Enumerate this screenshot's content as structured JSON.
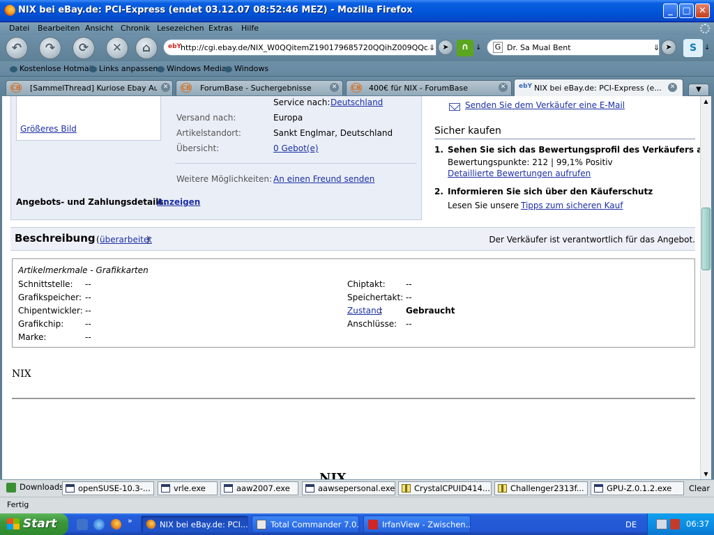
{
  "window": {
    "title": "NIX bei eBay.de: PCI-Express (endet 03.12.07 08:52:46 MEZ) - Mozilla Firefox",
    "min": "_",
    "max": "□",
    "close": "✕"
  },
  "menu": [
    "Datei",
    "Bearbeiten",
    "Ansicht",
    "Chronik",
    "Lesezeichen",
    "Extras",
    "Hilfe"
  ],
  "nav": {
    "back": "↶",
    "forward": "↷",
    "reload": "⟳",
    "stop": "✕",
    "home": "⌂",
    "url_favicon": "ebY",
    "url": "http://cgi.ebay.de/NIX_W0QQitemZ190179685720QQihZ009QQcategory",
    "url_drop": "⇓",
    "go": "➤",
    "rss": "∩",
    "rss_arrow": "↓",
    "search_engine": "G",
    "search_value": "Dr. Sa Mual Bent",
    "search_drop": "⇓",
    "search_go": "➤",
    "skype": "S",
    "skype_arrow": "↓"
  },
  "bookmarks": [
    "Kostenlose Hotmail",
    "Links anpassen",
    "Windows Media",
    "Windows"
  ],
  "tabs": [
    {
      "icon": "CB",
      "label": "[SammelThread] Kuriose Ebay Auk...",
      "close": "✕"
    },
    {
      "icon": "CB",
      "label": "ForumBase - Suchergebnisse",
      "close": "✕"
    },
    {
      "icon": "CB",
      "label": "400€ für NIX - ForumBase",
      "close": "✕"
    },
    {
      "icon": "ebY",
      "label": "NIX bei eBay.de: PCI-Express (e...",
      "close": "✕"
    }
  ],
  "tab_list": "▼",
  "item": {
    "bigger_image": "Größeres Bild",
    "service_label": "Service nach:",
    "service_value": "Deutschland",
    "shipping_label": "Versand nach:",
    "shipping_value": "Europa",
    "location_label": "Artikelstandort:",
    "location_value": "Sankt Englmar, Deutschland",
    "overview_label": "Übersicht:",
    "overview_value": "0 Gebot(e)",
    "more_label": "Weitere Möglichkeiten:",
    "more_value": "An einen Freund senden",
    "payment_label": "Angebots- und Zahlungsdetails:",
    "payment_link": "Anzeigen"
  },
  "seller": {
    "mail_link": "Senden Sie dem Verkäufer eine E-Mail",
    "safe_title": "Sicher kaufen",
    "step1_num": "1.",
    "step1_title": "Sehen Sie sich das Bewertungsprofil des Verkäufers an",
    "step1_score": "Bewertungspunkte: 212 | 99,1% Positiv",
    "step1_link": "Detaillierte Bewertungen aufrufen",
    "step2_num": "2.",
    "step2_title": "Informieren Sie sich über den Käuferschutz",
    "step2_text": "Lesen Sie unsere",
    "step2_link": "Tipps zum sicheren Kauf"
  },
  "description": {
    "title": "Beschreibung",
    "edited": "überarbeitet",
    "paren_open": "(",
    "paren_close": ")",
    "responsibility": "Der Verkäufer ist verantwortlich für das Angebot.",
    "specs_title": "Artikelmerkmale - Grafikkarten",
    "left_specs": [
      {
        "label": "Schnittstelle:",
        "value": "--"
      },
      {
        "label": "Grafikspeicher:",
        "value": "--"
      },
      {
        "label": "Chipentwickler:",
        "value": "--"
      },
      {
        "label": "Grafikchip:",
        "value": "--"
      },
      {
        "label": "Marke:",
        "value": "--"
      }
    ],
    "right_specs": [
      {
        "label": "Chiptakt:",
        "value": "--"
      },
      {
        "label": "Speichertakt:",
        "value": "--"
      },
      {
        "label": "Zustand",
        "value": "Gebraucht"
      },
      {
        "label": "Anschlüsse:",
        "value": "--"
      }
    ],
    "colon": ":",
    "body_text": "NIX",
    "partial_text": "NIX"
  },
  "downloads": {
    "label": "Downloads",
    "items": [
      "openSUSE-10.3-...",
      "vrle.exe",
      "aaw2007.exe",
      "aawsepersonal.exe",
      "CrystalCPUID414...",
      "Challenger2313f...",
      "GPU-Z.0.1.2.exe"
    ],
    "clear": "Clear"
  },
  "status": "Fertig",
  "taskbar": {
    "start": "Start",
    "more": "»",
    "tasks": [
      "NIX bei eBay.de: PCI...",
      "Total Commander 7.0...",
      "IrfanView - Zwischen..."
    ],
    "lang": "DE",
    "clock": "06:37"
  }
}
